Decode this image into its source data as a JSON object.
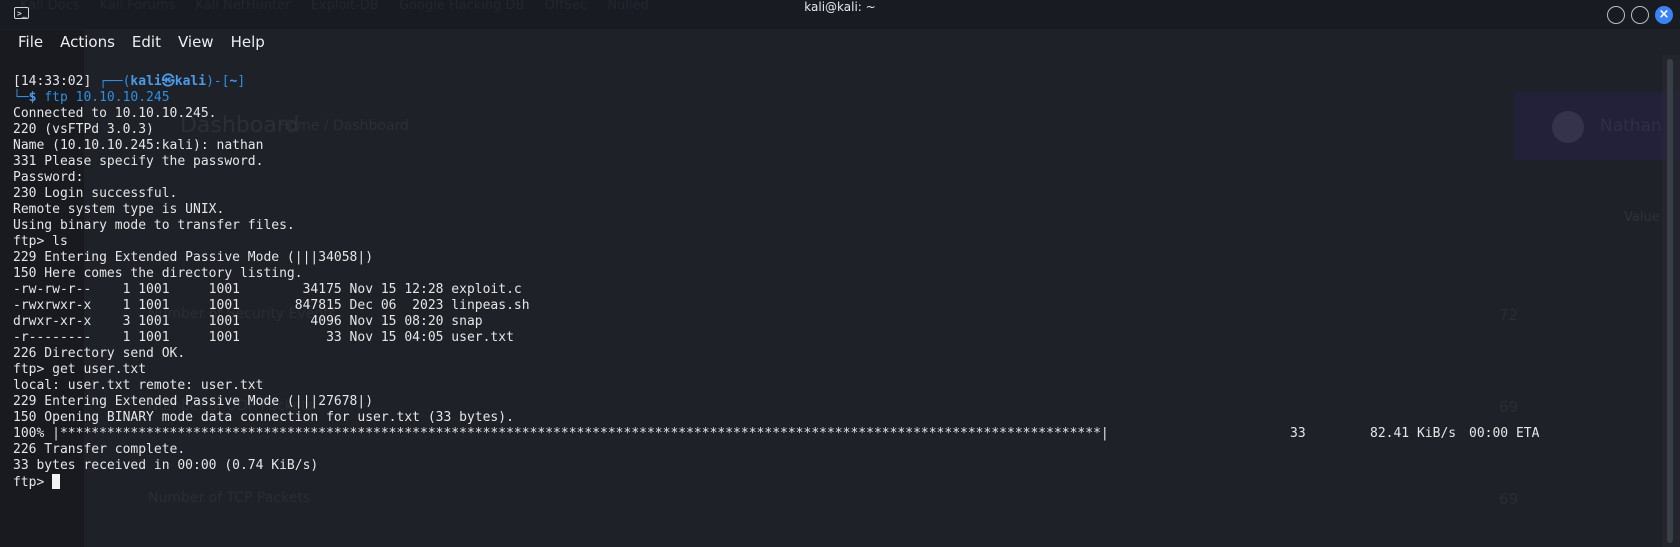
{
  "window": {
    "title": "kali@kali: ~",
    "app_icon": "terminal-icon"
  },
  "menu": [
    "File",
    "Actions",
    "Edit",
    "View",
    "Help"
  ],
  "background_app": {
    "bookmarks": [
      "Kali Docs",
      "Kali Forums",
      "Kali NetHunter",
      "Exploit-DB",
      "Google Hacking DB",
      "OffSec",
      "Nulled"
    ],
    "dashboard_title": "Dashboard",
    "breadcrumb": "Home / Dashboard",
    "user_name": "Nathan",
    "value_header": "Value",
    "rows": [
      {
        "label": "Number of Security Events",
        "value": "72"
      },
      {
        "label": "Number of UDP Packets",
        "value": "69"
      },
      {
        "label": "Number of TCP Packets",
        "value": "69"
      }
    ]
  },
  "terminal": {
    "prompt": {
      "time": "[14:33:02]",
      "user": "kali",
      "at_symbol": "㉿",
      "host": "kali",
      "cwd": "~",
      "command": "ftp 10.10.10.245"
    },
    "output_lines": [
      "Connected to 10.10.10.245.",
      "220 (vsFTPd 3.0.3)",
      "Name (10.10.10.245:kali): nathan",
      "331 Please specify the password.",
      "Password:",
      "230 Login successful.",
      "Remote system type is UNIX.",
      "Using binary mode to transfer files.",
      "ftp> ls",
      "229 Entering Extended Passive Mode (|||34058|)",
      "150 Here comes the directory listing.",
      "-rw-rw-r--    1 1001     1001        34175 Nov 15 12:28 exploit.c",
      "-rwxrwxr-x    1 1001     1001       847815 Dec 06  2023 linpeas.sh",
      "drwxr-xr-x    3 1001     1001         4096 Nov 15 08:20 snap",
      "-r--------    1 1001     1001           33 Nov 15 04:05 user.txt",
      "226 Directory send OK.",
      "ftp> get user.txt",
      "local: user.txt remote: user.txt",
      "229 Entering Extended Passive Mode (|||27678|)",
      "150 Opening BINARY mode data connection for user.txt (33 bytes)."
    ],
    "progress": {
      "percent": "100%",
      "bar": "|*************************************************************************************************************************************|",
      "bytes": "33",
      "rate": "82.41 KiB/s",
      "eta": "00:00 ETA"
    },
    "after_lines": [
      "226 Transfer complete.",
      "33 bytes received in 00:00 (0.74 KiB/s)"
    ],
    "final_prompt": "ftp> "
  }
}
